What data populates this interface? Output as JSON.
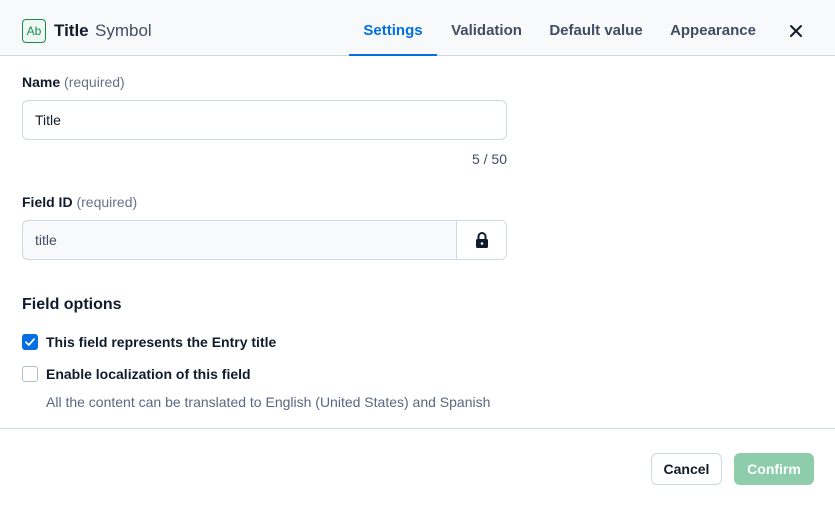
{
  "header": {
    "type_icon_text": "Ab",
    "title": "Title",
    "subtitle": "Symbol",
    "close_icon": "close-icon"
  },
  "tabs": [
    {
      "label": "Settings",
      "active": true
    },
    {
      "label": "Validation",
      "active": false
    },
    {
      "label": "Default value",
      "active": false
    },
    {
      "label": "Appearance",
      "active": false
    }
  ],
  "name_field": {
    "label": "Name",
    "required": "(required)",
    "value": "Title",
    "counter": "5 / 50"
  },
  "field_id": {
    "label": "Field ID",
    "required": "(required)",
    "value": "title",
    "lock_icon": "lock-icon"
  },
  "field_options": {
    "title": "Field options",
    "entry_title": {
      "label": "This field represents the Entry title",
      "checked": true
    },
    "localization": {
      "label": "Enable localization of this field",
      "checked": false,
      "help": "All the content can be translated to English (United States) and Spanish"
    }
  },
  "footer": {
    "cancel": "Cancel",
    "confirm": "Confirm"
  },
  "colors": {
    "accent": "#036fe3",
    "confirm_bg": "#8ecdac",
    "type_icon": "#1a8a55"
  }
}
